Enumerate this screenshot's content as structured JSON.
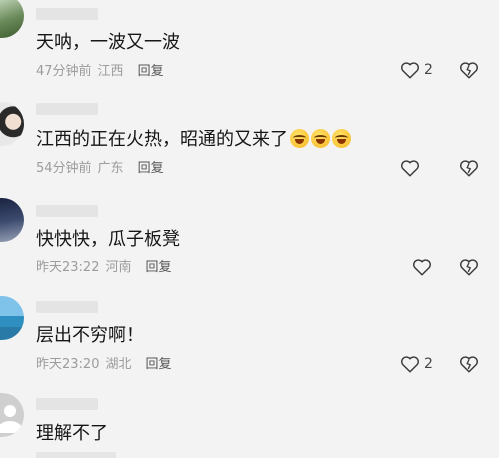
{
  "comments": [
    {
      "text": "天呐，一波又一波",
      "time": "47分钟前",
      "location": "江西",
      "reply": "回复",
      "likes": "2",
      "icons": {
        "like": "heart-outline-icon",
        "dislike": "broken-heart-icon"
      }
    },
    {
      "text": "江西的正在火热，昭通的又来了",
      "time": "54分钟前",
      "location": "广东",
      "reply": "回复",
      "likes": "",
      "emojis": [
        "laugh-cry-emoji",
        "laugh-cry-emoji",
        "laugh-cry-emoji"
      ]
    },
    {
      "text": "快快快，瓜子板凳",
      "time": "昨天23:22",
      "location": "河南",
      "reply": "回复",
      "likes": ""
    },
    {
      "text": "层出不穷啊！",
      "time": "昨天23:20",
      "location": "湖北",
      "reply": "回复",
      "likes": "2"
    },
    {
      "text": "理解不了",
      "time": "",
      "location": "",
      "reply": "",
      "likes": ""
    }
  ],
  "colors": {
    "background": "#f3f3f3",
    "text": "#161616",
    "meta": "#9c9c9c"
  }
}
